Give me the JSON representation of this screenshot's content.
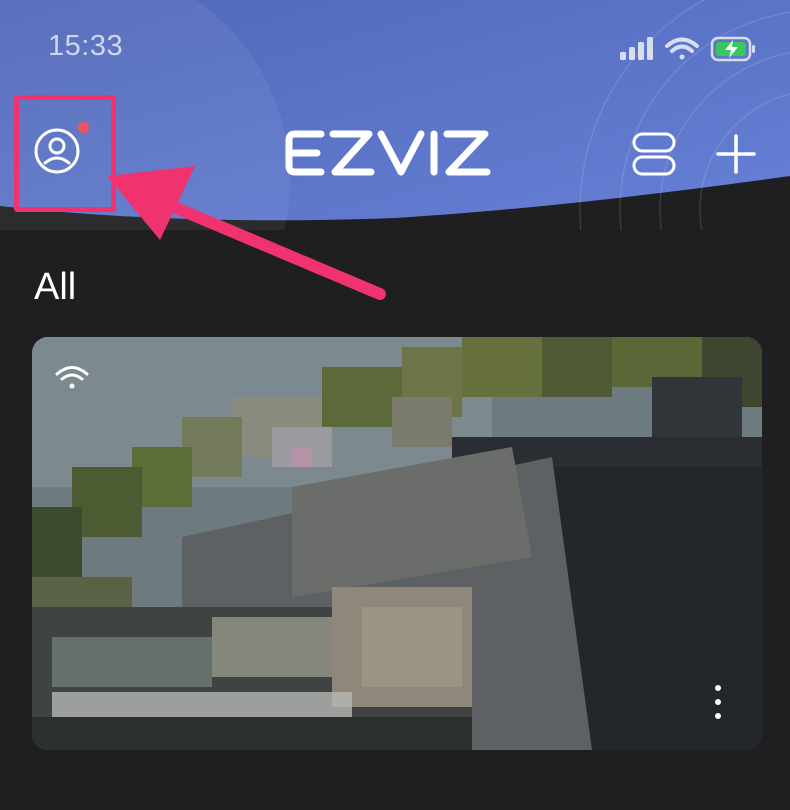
{
  "status_bar": {
    "time": "15:33",
    "icons": [
      "signal-icon",
      "wifi-icon",
      "battery-charging-icon"
    ]
  },
  "header": {
    "logo_text": "EZVIZ",
    "left_icon": "profile-icon",
    "has_notification": true,
    "right_icons": [
      "layout-toggle-icon",
      "add-icon"
    ]
  },
  "annotation": {
    "type": "highlight-with-arrow",
    "target": "profile-button",
    "color": "#f0336f"
  },
  "main": {
    "section_title": "All",
    "devices": [
      {
        "status_icon": "wifi-icon",
        "menu_icon": "more-vertical-icon"
      }
    ]
  },
  "colors": {
    "header_blue": "#5d75c9",
    "background": "#1f1f21",
    "notification_dot": "#f4525f",
    "annotation": "#f0336f"
  }
}
